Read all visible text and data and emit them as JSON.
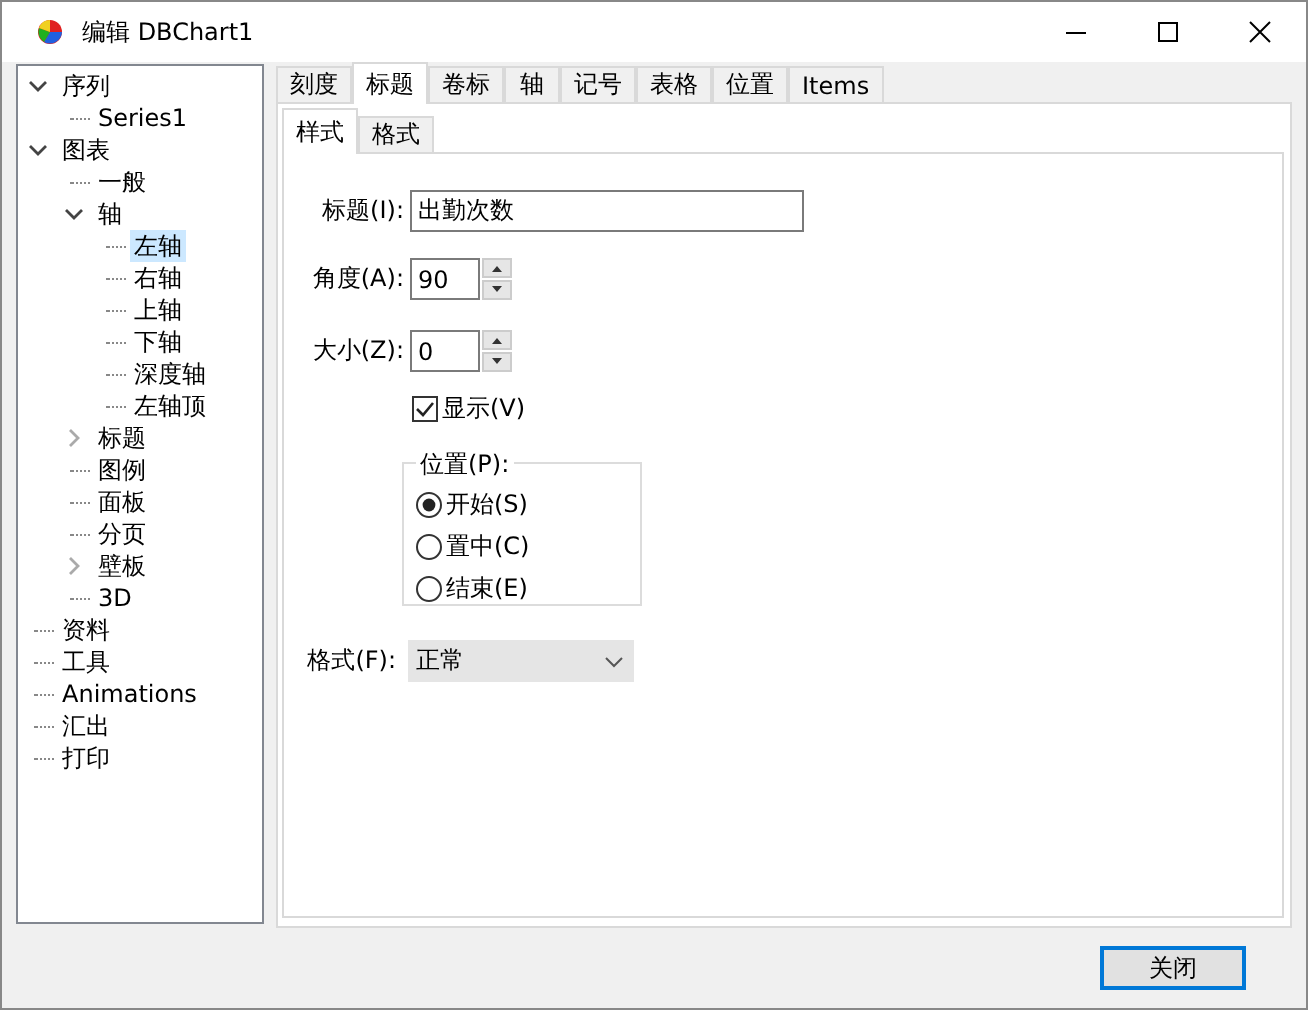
{
  "window": {
    "title": "编辑 DBChart1"
  },
  "tree": [
    {
      "label": "序列",
      "expanded": true,
      "selected": false,
      "children": [
        {
          "label": "Series1",
          "selected": false
        }
      ]
    },
    {
      "label": "图表",
      "expanded": true,
      "selected": false,
      "children": [
        {
          "label": "一般",
          "selected": false
        },
        {
          "label": "轴",
          "expanded": true,
          "selected": false,
          "children": [
            {
              "label": "左轴",
              "selected": true
            },
            {
              "label": "右轴",
              "selected": false
            },
            {
              "label": "上轴",
              "selected": false
            },
            {
              "label": "下轴",
              "selected": false
            },
            {
              "label": "深度轴",
              "selected": false
            },
            {
              "label": "左轴顶",
              "selected": false
            }
          ]
        },
        {
          "label": "标题",
          "expanded": false,
          "selected": false
        },
        {
          "label": "图例",
          "selected": false
        },
        {
          "label": "面板",
          "selected": false
        },
        {
          "label": "分页",
          "selected": false
        },
        {
          "label": "壁板",
          "expanded": false,
          "selected": false
        },
        {
          "label": "3D",
          "selected": false
        }
      ]
    },
    {
      "label": "资料",
      "selected": false
    },
    {
      "label": "工具",
      "selected": false
    },
    {
      "label": "Animations",
      "selected": false
    },
    {
      "label": "汇出",
      "selected": false
    },
    {
      "label": "打印",
      "selected": false
    }
  ],
  "tabs": [
    {
      "label": "刻度",
      "selected": false
    },
    {
      "label": "标题",
      "selected": true
    },
    {
      "label": "卷标",
      "selected": false
    },
    {
      "label": "轴",
      "selected": false
    },
    {
      "label": "记号",
      "selected": false
    },
    {
      "label": "表格",
      "selected": false
    },
    {
      "label": "位置",
      "selected": false
    },
    {
      "label": "Items",
      "selected": false
    }
  ],
  "subtabs": [
    {
      "label": "样式",
      "selected": true
    },
    {
      "label": "格式",
      "selected": false
    }
  ],
  "form": {
    "title_label": "标题(I):",
    "title_value": "出勤次数",
    "angle_label": "角度(A):",
    "angle_value": "90",
    "size_label": "大小(Z):",
    "size_value": "0",
    "visible": {
      "label": "显示(V)",
      "checked": true
    },
    "position": {
      "label": "位置(P):",
      "options": [
        {
          "label": "开始(S)",
          "selected": true
        },
        {
          "label": "置中(C)",
          "selected": false
        },
        {
          "label": "结束(E)",
          "selected": false
        }
      ]
    },
    "format_label": "格式(F):",
    "format_value": "正常"
  },
  "buttons": [
    "关闭"
  ]
}
